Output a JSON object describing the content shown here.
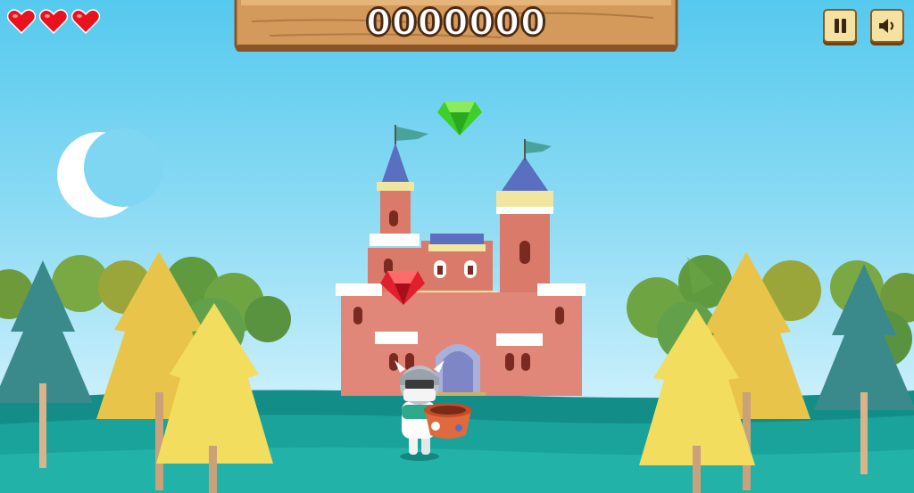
{
  "game": {
    "score": "0000000",
    "lives": 3,
    "controls": {
      "pause_icon": "pause-icon",
      "sound_icon": "speaker-icon"
    },
    "falling_gems": [
      {
        "kind": "emerald",
        "color": "#3ecf2a"
      },
      {
        "kind": "ruby",
        "color": "#e0202e"
      }
    ],
    "colors": {
      "heart": "#e8131f",
      "score_board": "#d49a5c",
      "button_face": "#f6e2a0"
    }
  }
}
